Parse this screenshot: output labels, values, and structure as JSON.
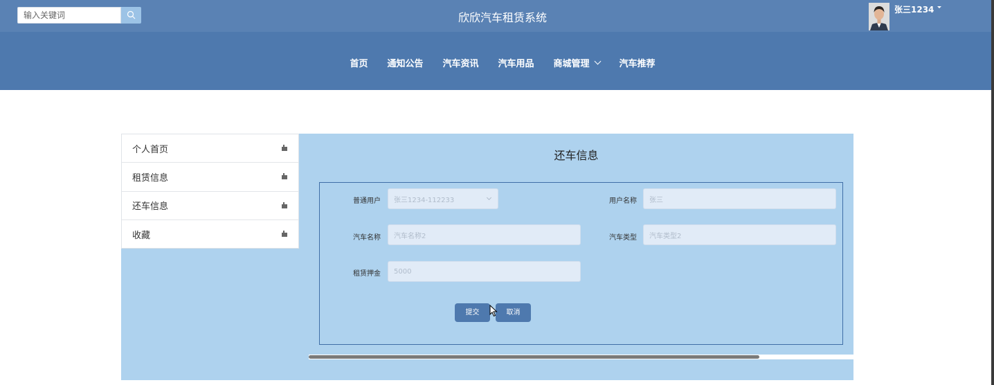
{
  "header": {
    "search_placeholder": "输入关键词",
    "site_title": "欣欣汽车租赁系统",
    "user_name": "张三1234"
  },
  "nav": {
    "items": [
      {
        "label": "首页"
      },
      {
        "label": "通知公告"
      },
      {
        "label": "汽车资讯"
      },
      {
        "label": "汽车用品"
      },
      {
        "label": "商城管理",
        "has_dropdown": true
      },
      {
        "label": "汽车推荐"
      }
    ]
  },
  "sidebar": {
    "items": [
      {
        "label": "个人首页"
      },
      {
        "label": "租赁信息"
      },
      {
        "label": "还车信息"
      },
      {
        "label": "收藏"
      }
    ]
  },
  "form": {
    "title": "还车信息",
    "fields": {
      "regular_user": {
        "label": "普通用户",
        "value": "张三1234-112233"
      },
      "user_name": {
        "label": "用户名称",
        "value": "张三"
      },
      "car_name": {
        "label": "汽车名称",
        "value": "汽车名称2"
      },
      "car_type": {
        "label": "汽车类型",
        "value": "汽车类型2"
      },
      "deposit": {
        "label": "租赁押金",
        "value": "5000"
      }
    },
    "submit_label": "提交",
    "cancel_label": "取消"
  },
  "colors": {
    "topbar": "#5a82b4",
    "navbar": "#4e79ae",
    "panel": "#aed2ee",
    "button": "#4e79ae",
    "field": "#e1ebf7"
  }
}
